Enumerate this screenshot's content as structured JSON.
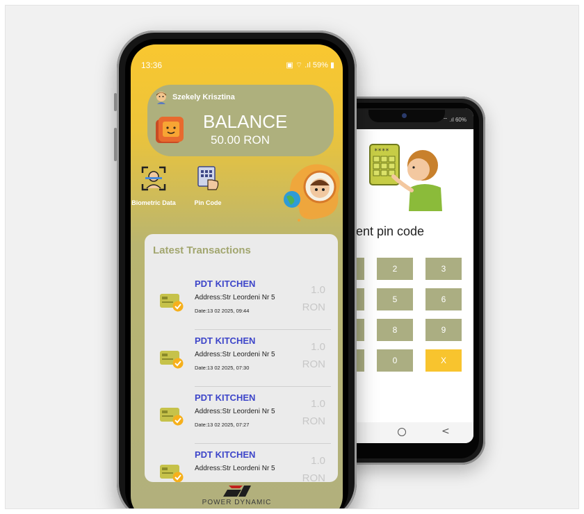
{
  "back_phone": {
    "status": "60%",
    "pin_title": "r current pin code",
    "keys": [
      "",
      "2",
      "3",
      "",
      "5",
      "6",
      "",
      "8",
      "9",
      "",
      "0",
      "X"
    ]
  },
  "front_phone": {
    "status": {
      "time": "13:36",
      "icons": "59%"
    },
    "user": {
      "name": "Szekely Krisztina"
    },
    "balance": {
      "label": "BALANCE",
      "value": "50.00 RON"
    },
    "quick_actions": [
      {
        "label": "Biometric Data",
        "icon": "face-scan-icon"
      },
      {
        "label": "Pin Code",
        "icon": "keypad-touch-icon"
      }
    ],
    "transactions_title": "Latest Transactions",
    "transactions": [
      {
        "name": "PDT KITCHEN",
        "address": "Address:Str Leordeni Nr 5",
        "date": "Date:13 02 2025, 09:44",
        "amount": "1.0",
        "currency": "RON"
      },
      {
        "name": "PDT KITCHEN",
        "address": "Address:Str Leordeni Nr 5",
        "date": "Date:13 02 2025, 07:30",
        "amount": "1.0",
        "currency": "RON"
      },
      {
        "name": "PDT KITCHEN",
        "address": "Address:Str Leordeni Nr 5",
        "date": "Date:13 02 2025, 07:27",
        "amount": "1.0",
        "currency": "RON"
      },
      {
        "name": "PDT KITCHEN",
        "address": "Address:Str Leordeni Nr 5",
        "date": "",
        "amount": "1.0",
        "currency": "RON"
      }
    ],
    "brand": "POWER DYNAMIC"
  },
  "colors": {
    "accent_yellow": "#f8c42e",
    "olive": "#aeb07d",
    "tx_name": "#3d45c9",
    "panel": "#ebebeb"
  }
}
